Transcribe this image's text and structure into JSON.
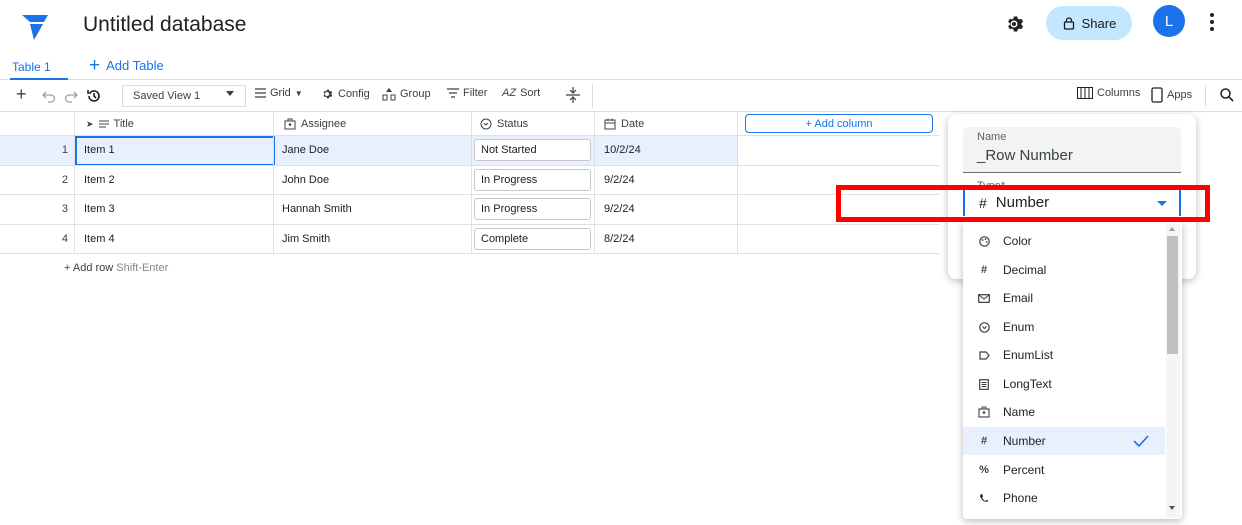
{
  "header": {
    "title": "Untitled database",
    "share_label": "Share",
    "avatar_initial": "L"
  },
  "tabs": {
    "table_tab": "Table 1",
    "add_table": "Add Table"
  },
  "toolbar": {
    "saved_view": "Saved View 1",
    "grid": "Grid",
    "config": "Config",
    "group": "Group",
    "filter": "Filter",
    "sort": "Sort",
    "columns": "Columns",
    "apps": "Apps"
  },
  "grid": {
    "columns": [
      "Title",
      "Assignee",
      "Status",
      "Date"
    ],
    "add_column": "+ Add column",
    "rows": [
      {
        "num": "1",
        "title": "Item 1",
        "assignee": "Jane Doe",
        "status": "Not Started",
        "date": "10/2/24"
      },
      {
        "num": "2",
        "title": "Item 2",
        "assignee": "John Doe",
        "status": "In Progress",
        "date": "9/2/24"
      },
      {
        "num": "3",
        "title": "Item 3",
        "assignee": "Hannah Smith",
        "status": "In Progress",
        "date": "9/2/24"
      },
      {
        "num": "4",
        "title": "Item 4",
        "assignee": "Jim Smith",
        "status": "Complete",
        "date": "8/2/24"
      }
    ],
    "add_row": "+ Add row",
    "add_row_hint": "Shift-Enter"
  },
  "panel": {
    "name_label": "Name",
    "name_value": "_Row Number",
    "type_label": "Type*",
    "type_value": "Number"
  },
  "dropdown": {
    "options": [
      {
        "label": "Color",
        "icon": "palette-icon"
      },
      {
        "label": "Decimal",
        "icon": "hash-icon"
      },
      {
        "label": "Email",
        "icon": "envelope-icon"
      },
      {
        "label": "Enum",
        "icon": "circle-chevron-icon"
      },
      {
        "label": "EnumList",
        "icon": "tag-icon"
      },
      {
        "label": "LongText",
        "icon": "notes-icon"
      },
      {
        "label": "Name",
        "icon": "badge-icon"
      },
      {
        "label": "Number",
        "icon": "hash-icon",
        "selected": true
      },
      {
        "label": "Percent",
        "icon": "percent-icon"
      },
      {
        "label": "Phone",
        "icon": "phone-icon"
      }
    ]
  },
  "colors": {
    "accent": "#1a73e8",
    "share_bg": "#c2e7ff",
    "highlight": "#ff0000",
    "row_selected": "#e8f0fe"
  }
}
